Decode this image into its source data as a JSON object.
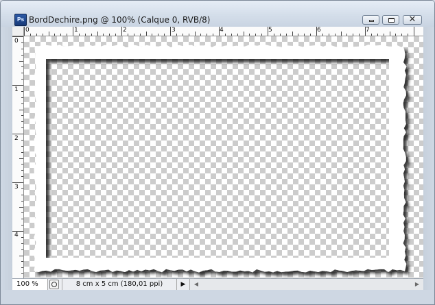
{
  "window": {
    "title": "BordDechire.png @ 100% (Calque 0, RVB/8)",
    "app_icon_text": "Ps",
    "controls": {
      "minimize_icon": "minimize-icon",
      "maximize_icon": "restore-icon",
      "close_icon": "close-icon",
      "close_glyph": "✕"
    }
  },
  "rulers": {
    "horizontal_labels": [
      "0",
      "1",
      "2",
      "3",
      "4",
      "5",
      "6",
      "7"
    ],
    "vertical_labels": [
      "0",
      "1",
      "2",
      "3",
      "4"
    ],
    "unit": "cm"
  },
  "status": {
    "zoom": "100 %",
    "doc_info": "8 cm x 5 cm (180,01 ppi)",
    "menu_arrow": "▶"
  },
  "scrollbar": {
    "left_arrow": "◀",
    "right_arrow": "▶"
  },
  "colors": {
    "checker_dark": "#cccccc",
    "checker_light": "#ffffff",
    "frame": "#ffffff",
    "shadow": "#555555"
  }
}
